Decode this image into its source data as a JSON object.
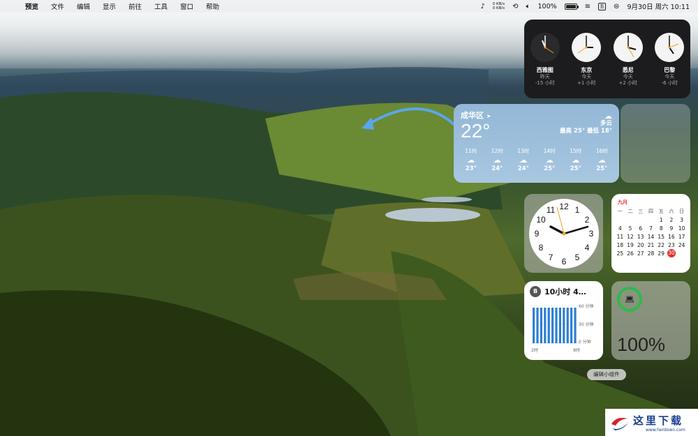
{
  "menubar": {
    "app_name": "预览",
    "menus": [
      "文件",
      "编辑",
      "显示",
      "前往",
      "工具",
      "窗口",
      "帮助"
    ],
    "net_up": "0 KB/s",
    "net_down": "0 KB/s",
    "battery_text": "100%",
    "datetime": "9月30日 周六  10:11"
  },
  "world_clock": [
    {
      "city": "西雅图",
      "day": "昨天",
      "offset": "-15 小时"
    },
    {
      "city": "东京",
      "day": "今天",
      "offset": "+1 小时"
    },
    {
      "city": "悉尼",
      "day": "今天",
      "offset": "+2 小时"
    },
    {
      "city": "巴黎",
      "day": "今天",
      "offset": "-6 小时"
    }
  ],
  "weather": {
    "location": "成华区",
    "temperature": "22°",
    "condition": "多云",
    "high_low": "最高 25° 最低 18°",
    "hourly": [
      {
        "hour": "11时",
        "temp": "23°"
      },
      {
        "hour": "12时",
        "temp": "24°"
      },
      {
        "hour": "13时",
        "temp": "24°"
      },
      {
        "hour": "14时",
        "temp": "25°"
      },
      {
        "hour": "15时",
        "temp": "25°"
      },
      {
        "hour": "16时",
        "temp": "25°"
      }
    ]
  },
  "calendar": {
    "month": "九月",
    "weekdays": [
      "一",
      "二",
      "三",
      "四",
      "五",
      "六",
      "日"
    ],
    "days": [
      "",
      "",
      "",
      "",
      "1",
      "2",
      "3",
      "4",
      "5",
      "6",
      "7",
      "8",
      "9",
      "10",
      "11",
      "12",
      "13",
      "14",
      "15",
      "16",
      "17",
      "18",
      "19",
      "20",
      "21",
      "22",
      "23",
      "24",
      "25",
      "26",
      "27",
      "28",
      "29",
      "30",
      ""
    ],
    "today": "30"
  },
  "screen_time": {
    "avatar": "B",
    "total": "10小时 4…",
    "y_labels": [
      "60 分钟",
      "30 分钟",
      "0 分钟"
    ],
    "x_labels": [
      "2时",
      "8时"
    ]
  },
  "battery_widget": {
    "percent": "100%",
    "level": 1.0
  },
  "edit_widgets": "编辑小组件",
  "watermark": {
    "cn": "这里下载",
    "url": "www.herdown.com"
  },
  "colors": {
    "calendar_accent": "#e0302a",
    "battery_ring": "#2fb94a",
    "screen_time_bar": "#2d7fd3"
  }
}
